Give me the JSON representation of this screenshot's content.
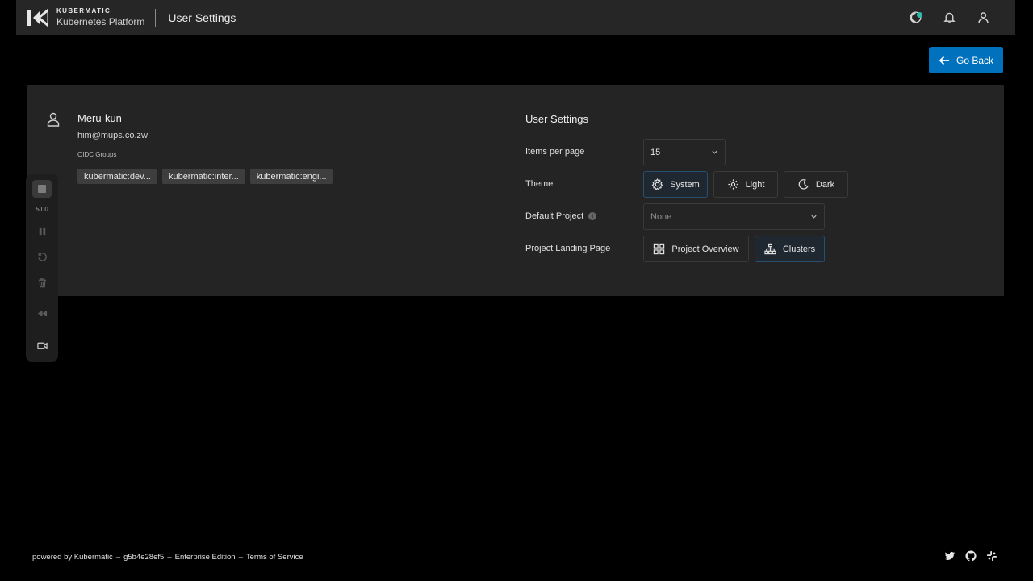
{
  "header": {
    "brand": "KUBERMATIC",
    "product": "Kubernetes Platform",
    "page_title": "User Settings",
    "icons": [
      "theme-status-icon",
      "bell-icon",
      "user-account-icon"
    ]
  },
  "actions": {
    "go_back_label": "Go Back"
  },
  "profile": {
    "name": "Meru-kun",
    "email": "him@mups.co.zw",
    "oidc_groups_label": "OIDC Groups",
    "oidc_groups": [
      "kubermatic:dev...",
      "kubermatic:inter...",
      "kubermatic:engi..."
    ]
  },
  "settings": {
    "title": "User Settings",
    "items_per_page_label": "Items per page",
    "items_per_page_value": "15",
    "theme_label": "Theme",
    "theme_options": [
      "System",
      "Light",
      "Dark"
    ],
    "theme_selected": "System",
    "default_project_label": "Default Project",
    "default_project_value": "None",
    "landing_page_label": "Project Landing Page",
    "landing_page_options": [
      "Project Overview",
      "Clusters"
    ],
    "landing_page_selected": "Clusters"
  },
  "recorder": {
    "time": "5:00"
  },
  "footer": {
    "powered_by": "powered by Kubermatic",
    "version": "g5b4e28ef5",
    "edition": "Enterprise Edition",
    "terms": "Terms of Service",
    "separator": "–"
  },
  "colors": {
    "accent": "#0071bc",
    "status_teal": "#2fb9b0",
    "card_bg": "#242424",
    "topbar_bg": "#262626"
  }
}
